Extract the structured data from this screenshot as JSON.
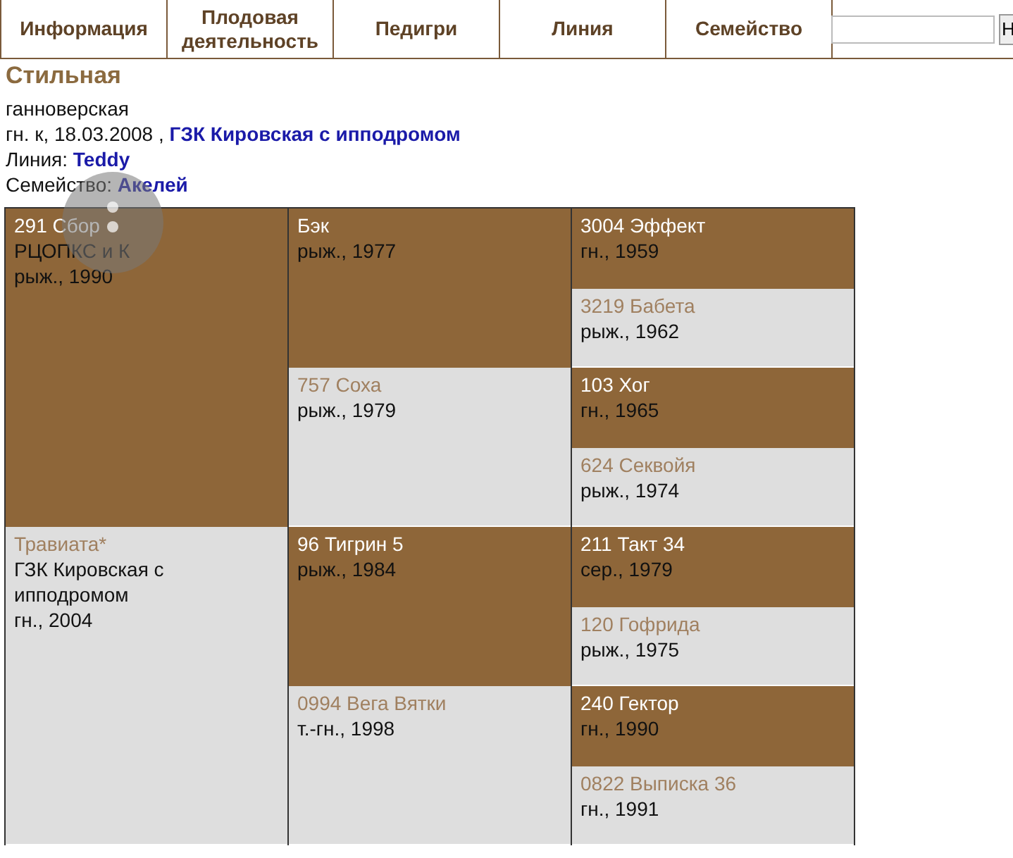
{
  "tabs": [
    {
      "label": "Информация"
    },
    {
      "label": "Плодовая деятельность"
    },
    {
      "label": "Педигри"
    },
    {
      "label": "Линия"
    },
    {
      "label": "Семейство"
    }
  ],
  "search": {
    "button": "Н"
  },
  "horse": {
    "name": "Стильная",
    "breed": "ганноверская",
    "details": "гн. к, 18.03.2008 ,",
    "owner": "ГЗК Кировская с ипподромом",
    "line_label": "Линия:",
    "line": "Teddy",
    "family_label": "Семейство:",
    "family": "Акелей"
  },
  "pedigree": [
    {
      "kind": "male",
      "name": "291 Сбор",
      "owner": "РЦОПКС и К",
      "info": "рыж., 1990",
      "parents": [
        {
          "kind": "male",
          "name": "Бэк",
          "info": "рыж., 1977",
          "parents": [
            {
              "kind": "male",
              "name": "3004 Эффект",
              "info": "гн., 1959"
            },
            {
              "kind": "female",
              "name": "3219 Бабета",
              "info": "рыж., 1962"
            }
          ]
        },
        {
          "kind": "female",
          "name": "757 Соха",
          "info": "рыж., 1979",
          "parents": [
            {
              "kind": "male",
              "name": "103 Хог",
              "info": "гн., 1965"
            },
            {
              "kind": "female",
              "name": "624 Секвойя",
              "info": "рыж., 1974"
            }
          ]
        }
      ]
    },
    {
      "kind": "female",
      "name": "Травиата*",
      "owner": "ГЗК Кировская с ипподромом",
      "info": "гн., 2004",
      "parents": [
        {
          "kind": "male",
          "name": "96 Тигрин 5",
          "info": "рыж., 1984",
          "parents": [
            {
              "kind": "male",
              "name": "211 Такт 34",
              "info": "сер., 1979"
            },
            {
              "kind": "female",
              "name": "120 Гофрида",
              "info": "рыж., 1975"
            }
          ]
        },
        {
          "kind": "female",
          "name": "0994 Вега Вятки",
          "info": "т.-гн., 1998",
          "parents": [
            {
              "kind": "male",
              "name": "240 Гектор",
              "info": "гн., 1990"
            },
            {
              "kind": "female",
              "name": "0822 Выписка 36",
              "info": "гн., 1991"
            }
          ]
        }
      ]
    }
  ]
}
